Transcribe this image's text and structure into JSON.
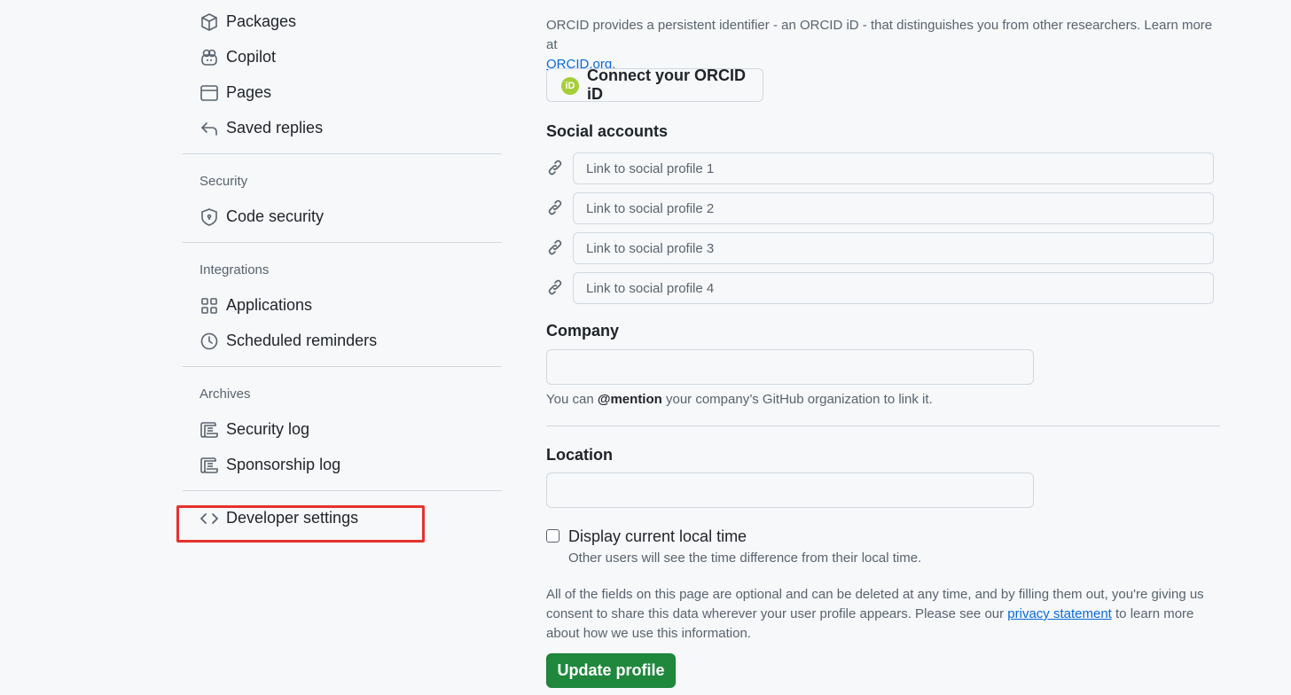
{
  "sidebar": {
    "items_top": [
      {
        "label": "Packages",
        "icon": "package-icon"
      },
      {
        "label": "Copilot",
        "icon": "copilot-icon"
      },
      {
        "label": "Pages",
        "icon": "browser-icon"
      },
      {
        "label": "Saved replies",
        "icon": "reply-icon"
      }
    ],
    "security": {
      "title": "Security",
      "items": [
        {
          "label": "Code security",
          "icon": "shield-icon"
        }
      ]
    },
    "integrations": {
      "title": "Integrations",
      "items": [
        {
          "label": "Applications",
          "icon": "apps-grid-icon"
        },
        {
          "label": "Scheduled reminders",
          "icon": "clock-icon"
        }
      ]
    },
    "archives": {
      "title": "Archives",
      "items": [
        {
          "label": "Security log",
          "icon": "log-icon"
        },
        {
          "label": "Sponsorship log",
          "icon": "log-icon"
        }
      ]
    },
    "developer": {
      "label": "Developer settings",
      "icon": "code-icon"
    }
  },
  "orcid": {
    "description": "ORCID provides a persistent identifier - an ORCID iD - that distinguishes you from other researchers. Learn more at",
    "link": "ORCID.org",
    "after_link": ".",
    "badge": "iD",
    "button": "Connect your ORCID iD"
  },
  "social": {
    "title": "Social accounts",
    "placeholders": [
      "Link to social profile 1",
      "Link to social profile 2",
      "Link to social profile 3",
      "Link to social profile 4"
    ]
  },
  "company": {
    "label": "Company",
    "value": "",
    "hint_pre": "You can ",
    "hint_bold": "@mention",
    "hint_post": " your company’s GitHub organization to link it."
  },
  "location": {
    "label": "Location",
    "value": ""
  },
  "local_time": {
    "checked": false,
    "label": "Display current local time",
    "hint": "Other users will see the time difference from their local time."
  },
  "notice": {
    "line1": "All of the fields on this page are optional and can be deleted at any time, and by filling them out, you're giving us",
    "line2_pre": "consent to share this data wherever your user profile appears. Please see our ",
    "link": "privacy statement",
    "line2_post": " to learn more",
    "line3": "about how we use this information."
  },
  "update_button": "Update profile",
  "colors": {
    "accent": "#0969da",
    "primary_button": "#1f883d",
    "highlight": "#e5322d",
    "orcid": "#a6ce39"
  }
}
